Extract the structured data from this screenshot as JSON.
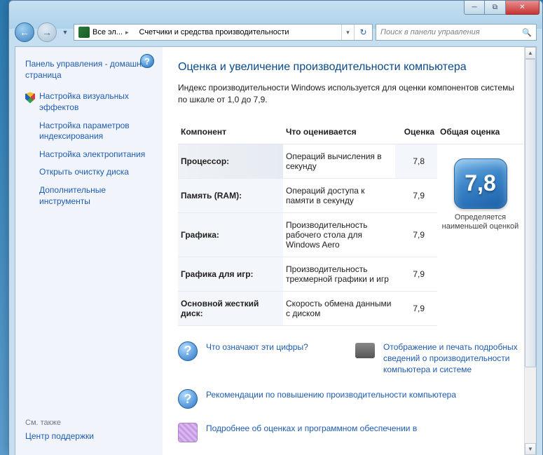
{
  "titlebar": {
    "min": "─",
    "max": "⧉",
    "close": "✕"
  },
  "nav": {
    "crumb1": "Все эл...",
    "crumb2": "Счетчики и средства производительности",
    "search_placeholder": "Поиск в панели управления"
  },
  "sidebar": {
    "home": "Панель управления - домашняя страница",
    "items": [
      "Настройка визуальных эффектов",
      "Настройка параметров индексирования",
      "Настройка электропитания",
      "Открыть очистку диска",
      "Дополнительные инструменты"
    ],
    "also_head": "См. также",
    "also_link": "Центр поддержки"
  },
  "main": {
    "title": "Оценка и увеличение производительности компьютера",
    "intro": "Индекс производительности Windows используется для оценки компонентов системы по шкале от 1,0 до 7,9.",
    "headers": {
      "comp": "Компонент",
      "desc": "Что оценивается",
      "score": "Оценка",
      "base": "Общая оценка"
    },
    "rows": [
      {
        "comp": "Процессор:",
        "desc": "Операций вычисления в секунду",
        "score": "7,8"
      },
      {
        "comp": "Память (RAM):",
        "desc": "Операций доступа к памяти в секунду",
        "score": "7,9"
      },
      {
        "comp": "Графика:",
        "desc": "Производительность рабочего стола для Windows Aero",
        "score": "7,9"
      },
      {
        "comp": "Графика для игр:",
        "desc": "Производительность трехмерной графики и игр",
        "score": "7,9"
      },
      {
        "comp": "Основной жесткий диск:",
        "desc": "Скорость обмена данными с диском",
        "score": "7,9"
      }
    ],
    "base_score": "7,8",
    "base_caption": "Определяется наименьшей оценкой",
    "links": {
      "what": "Что означают эти цифры?",
      "reco": "Рекомендации по повышению производительности компьютера",
      "print": "Отображение и печать подробных сведений о производительности компьютера и системе",
      "soft": "Подробнее об оценках и программном обеспечении в"
    }
  }
}
